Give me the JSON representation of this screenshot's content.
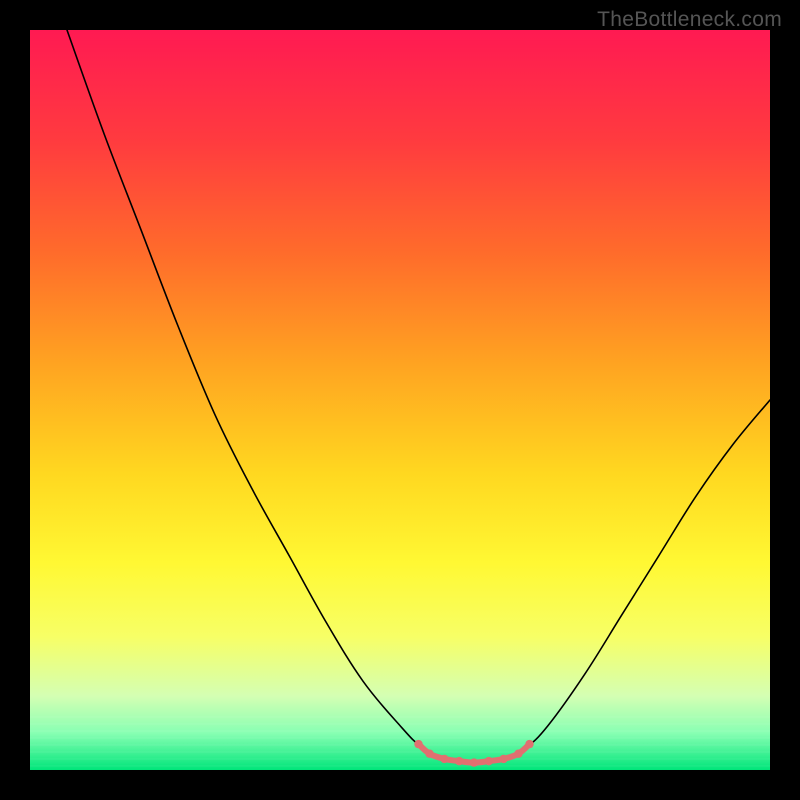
{
  "watermark": "TheBottleneck.com",
  "chart_data": {
    "type": "line",
    "title": "",
    "xlabel": "",
    "ylabel": "",
    "xlim": [
      0,
      100
    ],
    "ylim": [
      0,
      100
    ],
    "background_gradient": {
      "stops": [
        {
          "pos": 0.0,
          "color": "#ff1a52"
        },
        {
          "pos": 0.15,
          "color": "#ff3b3f"
        },
        {
          "pos": 0.3,
          "color": "#ff6b2b"
        },
        {
          "pos": 0.45,
          "color": "#ffa321"
        },
        {
          "pos": 0.6,
          "color": "#ffd820"
        },
        {
          "pos": 0.72,
          "color": "#fff833"
        },
        {
          "pos": 0.82,
          "color": "#f7ff66"
        },
        {
          "pos": 0.9,
          "color": "#d4ffb3"
        },
        {
          "pos": 0.95,
          "color": "#88ffb3"
        },
        {
          "pos": 1.0,
          "color": "#00e57a"
        }
      ]
    },
    "series": [
      {
        "name": "bottleneck-curve",
        "color": "#000000",
        "width": 1.6,
        "points": [
          {
            "x": 5.0,
            "y": 100.0
          },
          {
            "x": 10.0,
            "y": 86.0
          },
          {
            "x": 15.0,
            "y": 73.0
          },
          {
            "x": 20.0,
            "y": 60.0
          },
          {
            "x": 25.0,
            "y": 48.0
          },
          {
            "x": 30.0,
            "y": 38.0
          },
          {
            "x": 35.0,
            "y": 29.0
          },
          {
            "x": 40.0,
            "y": 20.0
          },
          {
            "x": 45.0,
            "y": 12.0
          },
          {
            "x": 50.0,
            "y": 6.0
          },
          {
            "x": 53.0,
            "y": 3.0
          },
          {
            "x": 56.0,
            "y": 1.5
          },
          {
            "x": 60.0,
            "y": 1.0
          },
          {
            "x": 64.0,
            "y": 1.5
          },
          {
            "x": 67.0,
            "y": 3.0
          },
          {
            "x": 70.0,
            "y": 6.0
          },
          {
            "x": 75.0,
            "y": 13.0
          },
          {
            "x": 80.0,
            "y": 21.0
          },
          {
            "x": 85.0,
            "y": 29.0
          },
          {
            "x": 90.0,
            "y": 37.0
          },
          {
            "x": 95.0,
            "y": 44.0
          },
          {
            "x": 100.0,
            "y": 50.0
          }
        ]
      },
      {
        "name": "target-segment",
        "color": "#e07070",
        "width": 6,
        "points": [
          {
            "x": 52.5,
            "y": 3.5
          },
          {
            "x": 54.0,
            "y": 2.2
          },
          {
            "x": 56.0,
            "y": 1.5
          },
          {
            "x": 58.0,
            "y": 1.2
          },
          {
            "x": 60.0,
            "y": 1.0
          },
          {
            "x": 62.0,
            "y": 1.2
          },
          {
            "x": 64.0,
            "y": 1.5
          },
          {
            "x": 66.0,
            "y": 2.2
          },
          {
            "x": 67.5,
            "y": 3.5
          }
        ]
      }
    ]
  }
}
